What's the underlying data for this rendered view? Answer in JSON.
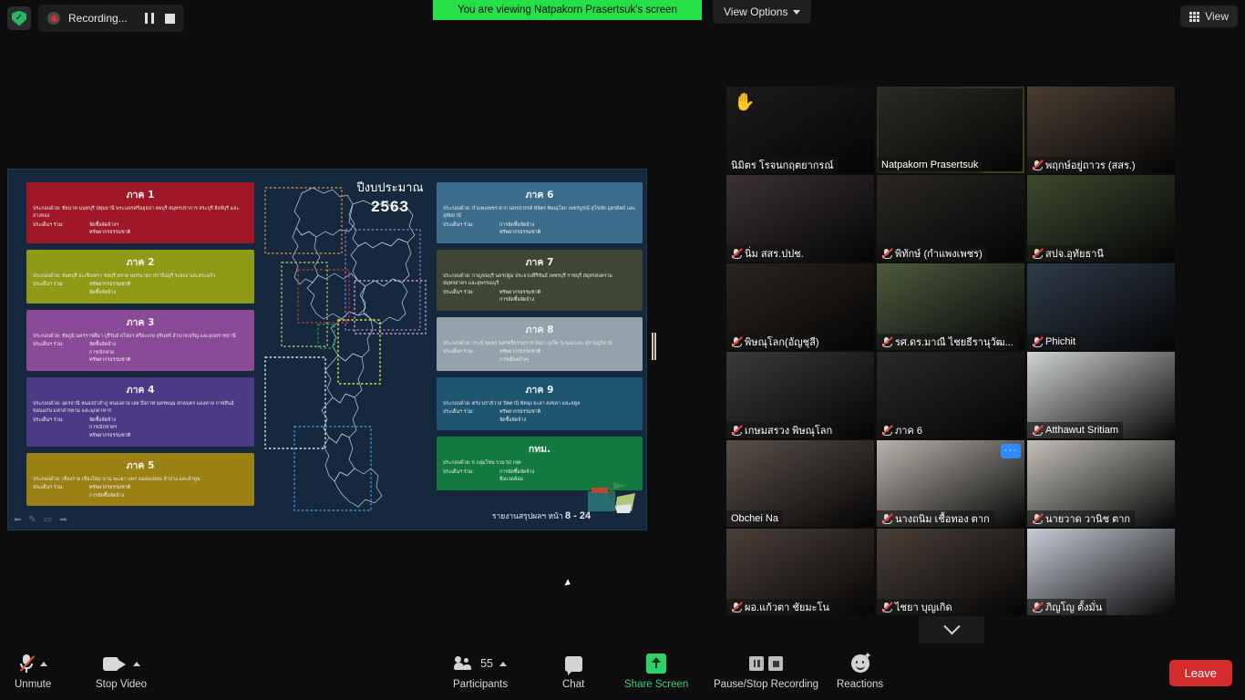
{
  "topbar": {
    "shield_icon": "security-shield-icon",
    "recording_label": "Recording...",
    "pause_icon": "pause-icon",
    "stop_icon": "stop-icon",
    "viewing_banner": "You are viewing Natpakorn Prasertsuk's screen",
    "view_options_label": "View Options",
    "view_button_label": "View"
  },
  "shared_screen": {
    "title": "ปีงบประมาณ",
    "year": "2563",
    "page_note_prefix": "รายงานสรุปผลฯ หน้า ",
    "page_note_value": "8 - 24",
    "left_regions": [
      {
        "name": "ภาค 1",
        "color": "#a01828",
        "provinces": "ประกอบด้วย: ชัยนาท นนทบุรี ปทุมธานี พระนครศรีอยุธยา ลพบุรี สมุทรปราการ สระบุรี สิงห์บุรี และอ่างทอง",
        "issue_label": "ประเด็นฯ ร่วม:",
        "issues": [
          "จัดซื้อจัดจ้างฯ",
          "ทรัพยากรธรรมชาติ"
        ]
      },
      {
        "name": "ภาค 2",
        "color": "#8f9b17",
        "provinces": "ประกอบด้วย: จันทบุรี ฉะเชิงเทรา ชลบุรี ตราด นครนายก ปราจีนบุรี ระยอง และสระแก้ว",
        "issue_label": "ประเด็นฯ ร่วม:",
        "issues": [
          "ทรัพยากรธรรมชาติ",
          "จัดซื้อจัดจ้าง"
        ]
      },
      {
        "name": "ภาค 3",
        "color": "#8b4a97",
        "provinces": "ประกอบด้วย: ชัยภูมิ นครราชสีมา บุรีรัมย์ ยโสธร ศรีสะเกษ สุรินทร์ อำนาจเจริญ และอุบลราชธานี",
        "issue_label": "ประเด็นฯ ร่วม:",
        "issues": [
          "จัดซื้อจัดจ้าง",
          "การเบิกจ่าย",
          "ทรัพยากรธรรมชาติ"
        ]
      },
      {
        "name": "ภาค 4",
        "color": "#4b3a86",
        "provinces": "ประกอบด้วย: อุดรธานี หนองบัวลำภู หนองคาย เลย บึงกาฬ นครพนม สกลนคร นองคาย กาฬสินธุ์ ขอนแก่น มหาสารคาม และมุกดาหาร",
        "issue_label": "ประเด็นฯ ร่วม:",
        "issues": [
          "จัดซื้อจัดจ้าง",
          "การเบิกจ่ายฯ",
          "ทรัพยากรธรรมชาติ"
        ]
      },
      {
        "name": "ภาค 5",
        "color": "#9b8014",
        "provinces": "ประกอบด้วย: เชียงราย เชียงใหม่ น่าน พะเยา แพร่ แม่ฮ่องสอน ลำปาง และลำพูน",
        "issue_label": "ประเด็นฯ ร่วม:",
        "issues": [
          "ทรัพยากรธรรมชาติ",
          "การจัดซื้อจัดจ้าง"
        ]
      }
    ],
    "right_regions": [
      {
        "name": "ภาค 6",
        "color": "#3c6d8c",
        "provinces": "ประกอบด้วย: กำแพงเพชร ตาก นครสวรรค์ พิจิตร พิษณุโลก เพชรบูรณ์ สุโขทัย อุตรดิตถ์ และอุทัยธานี",
        "issue_label": "ประเด็นฯ ร่วม:",
        "issues": [
          "การจัดซื้อจัดจ้าง",
          "ทรัพยากรธรรมชาติ"
        ]
      },
      {
        "name": "ภาค 7",
        "color": "#3f4633",
        "provinces": "ประกอบด้วย: กาญจนบุรี นครปฐม ประจวบคีรีขันธ์ เพชรบุรี ราชบุรี สมุทรสงคราม สมุทรสาคร และสุพรรณบุรี",
        "issue_label": "ประเด็นฯ ร่วม:",
        "issues": [
          "ทรัพยากรธรรมชาติ",
          "การจัดซื้อจัดจ้าง"
        ]
      },
      {
        "name": "ภาค 8",
        "color": "#93a2ab",
        "provinces": "ประกอบด้วย: กระบี่ ชุมพร นครศรีธรรมราช พังงา ภูเก็ต ระนอง และ สุราษฎร์ธานี",
        "issue_label": "ประเด็นฯ ร่วม:",
        "issues": [
          "ทรัพยากรธรรมชาติ",
          "การเมืองบ้างๆ"
        ]
      },
      {
        "name": "ภาค 9",
        "color": "#1e5570",
        "provinces": "ประกอบด้วย: ตรัง นราธิวาส ปัตตานี พัทลุง ยะลา สงขลา และสตูล",
        "issue_label": "ประเด็นฯ ร่วม:",
        "issues": [
          "ทรัพยากรธรรมชาติ",
          "จัดซื้อจัดจ้าง"
        ]
      },
      {
        "name": "กทม.",
        "color": "#127a3f",
        "provinces": "ประกอบด้วย:  6 กลุ่มโซน รวม 50 เขต",
        "issue_label": "ประเด็นฯ ร่วม:",
        "issues": [
          "การจัดซื้อจัดจ้าง",
          "สิ่งแวดล้อม"
        ]
      }
    ],
    "annotation_icons": [
      "undo-icon",
      "pen-icon",
      "eraser-icon",
      "redo-icon"
    ],
    "scrollbar_icon": "share-scroll-handle"
  },
  "gallery": {
    "rows": [
      [
        {
          "name": "นิมิตร โรจนกฤตยากรณ์",
          "muted": false,
          "hand_raised": true,
          "active": false,
          "bg": "#1c1c1c"
        },
        {
          "name": "Natpakorn Prasertsuk",
          "muted": false,
          "hand_raised": false,
          "active": true,
          "bg": "#2b2a24"
        },
        {
          "name": "พฤกษ์อยู่ถาวร (สสร.)",
          "muted": true,
          "hand_raised": false,
          "active": false,
          "bg": "#4a3d30"
        }
      ],
      [
        {
          "name": "นิ่ม สสร.ปปช.",
          "muted": true,
          "hand_raised": false,
          "active": false,
          "bg": "#3a3233"
        },
        {
          "name": "พิทักษ์ (กำแพงเพชร)",
          "muted": true,
          "hand_raised": false,
          "active": false,
          "bg": "#2a2723"
        },
        {
          "name": "สปจ.อุทัยธานี",
          "muted": true,
          "hand_raised": false,
          "active": false,
          "bg": "#3d4a2e"
        }
      ],
      [
        {
          "name": "พิษณุโลก(อัญชุลี)",
          "muted": true,
          "hand_raised": false,
          "active": false,
          "bg": "#2b241e"
        },
        {
          "name": "รศ.ดร.มาณี ไชยธีรานุวัฒ...",
          "muted": true,
          "hand_raised": false,
          "active": false,
          "bg": "#4c5b3e"
        },
        {
          "name": "Phichit",
          "muted": true,
          "hand_raised": false,
          "active": false,
          "bg": "#2e3c4a"
        }
      ],
      [
        {
          "name": "เกษมสรวง  พิษณุโลก",
          "muted": true,
          "hand_raised": false,
          "active": false,
          "bg": "#3b3a38"
        },
        {
          "name": "ภาค 6",
          "muted": true,
          "hand_raised": false,
          "active": false,
          "bg": "#29282a"
        },
        {
          "name": "Atthawut Sritiam",
          "muted": true,
          "hand_raised": false,
          "active": false,
          "bg": "#cfd3d2"
        }
      ],
      [
        {
          "name": "Obchei Na",
          "muted": false,
          "hand_raised": false,
          "active": false,
          "bg": "#5a5048"
        },
        {
          "name": "นางถนิม เชื้อทอง ตาก",
          "muted": true,
          "hand_raised": false,
          "active": false,
          "more": true,
          "bg": "#b9b4ac"
        },
        {
          "name": "นายวาด วานิช ตาก",
          "muted": true,
          "hand_raised": false,
          "active": false,
          "bg": "#c3c0b8"
        }
      ],
      [
        {
          "name": "ผอ.แก้วตา ชัยมะโน",
          "muted": true,
          "hand_raised": false,
          "active": false,
          "bg": "#4b4039"
        },
        {
          "name": "ไชยา บุญเกิด",
          "muted": true,
          "hand_raised": false,
          "active": false,
          "bg": "#4a4038"
        },
        {
          "name": "ภิญโญ ตั้งมั่น",
          "muted": true,
          "hand_raised": false,
          "active": false,
          "bg": "#c8cdd6"
        }
      ]
    ],
    "scroll_down_icon": "chevron-down-icon"
  },
  "toolbar": {
    "unmute_label": "Unmute",
    "stop_video_label": "Stop Video",
    "participants_label": "Participants",
    "participants_count": "55",
    "chat_label": "Chat",
    "share_screen_label": "Share Screen",
    "recording_label": "Pause/Stop Recording",
    "reactions_label": "Reactions",
    "leave_label": "Leave"
  },
  "colors": {
    "accent_green": "#26e04a",
    "share_green": "#2fd16a",
    "leave_red": "#d42c2c",
    "active_tile": "#e9ef4b",
    "slide_bg": "#15283d"
  }
}
